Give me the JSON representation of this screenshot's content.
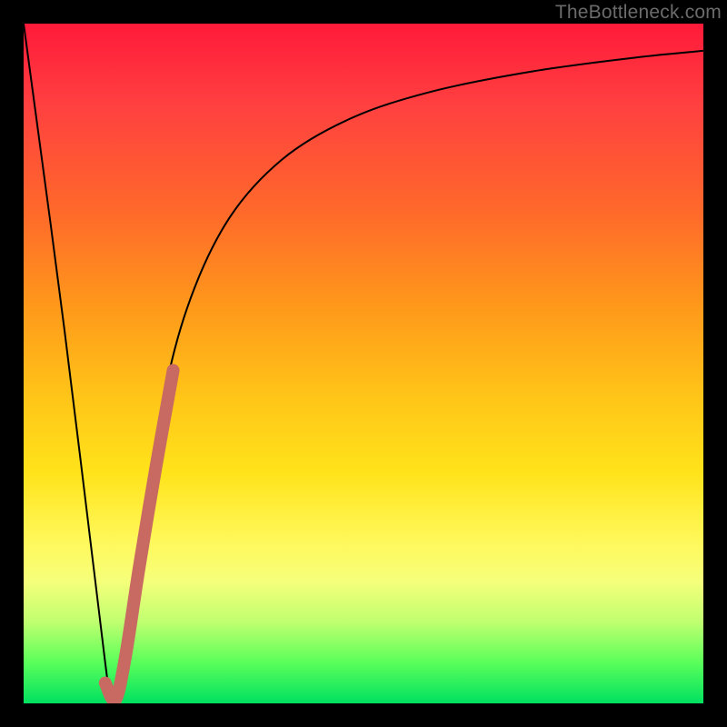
{
  "watermark": "TheBottleneck.com",
  "chart_data": {
    "type": "line",
    "title": "",
    "xlabel": "",
    "ylabel": "",
    "xlim": [
      0,
      100
    ],
    "ylim": [
      0,
      100
    ],
    "grid": false,
    "series": [
      {
        "name": "bottleneck-curve",
        "style": "thin-black",
        "x": [
          0,
          6,
          12,
          13,
          14,
          16,
          20,
          24,
          30,
          38,
          48,
          60,
          75,
          90,
          100
        ],
        "values": [
          100,
          55,
          6,
          0,
          4,
          18,
          42,
          58,
          71,
          80,
          86,
          90,
          93,
          95,
          96
        ]
      },
      {
        "name": "highlight-band",
        "style": "thick-salmon",
        "x": [
          12.0,
          13.5,
          15.0,
          17.0,
          19.5,
          22.0
        ],
        "values": [
          3.0,
          0.5,
          7.0,
          20.0,
          35.0,
          49.0
        ]
      }
    ],
    "colors": {
      "thin-black": "#000000",
      "thick-salmon": "#c86a62"
    }
  }
}
